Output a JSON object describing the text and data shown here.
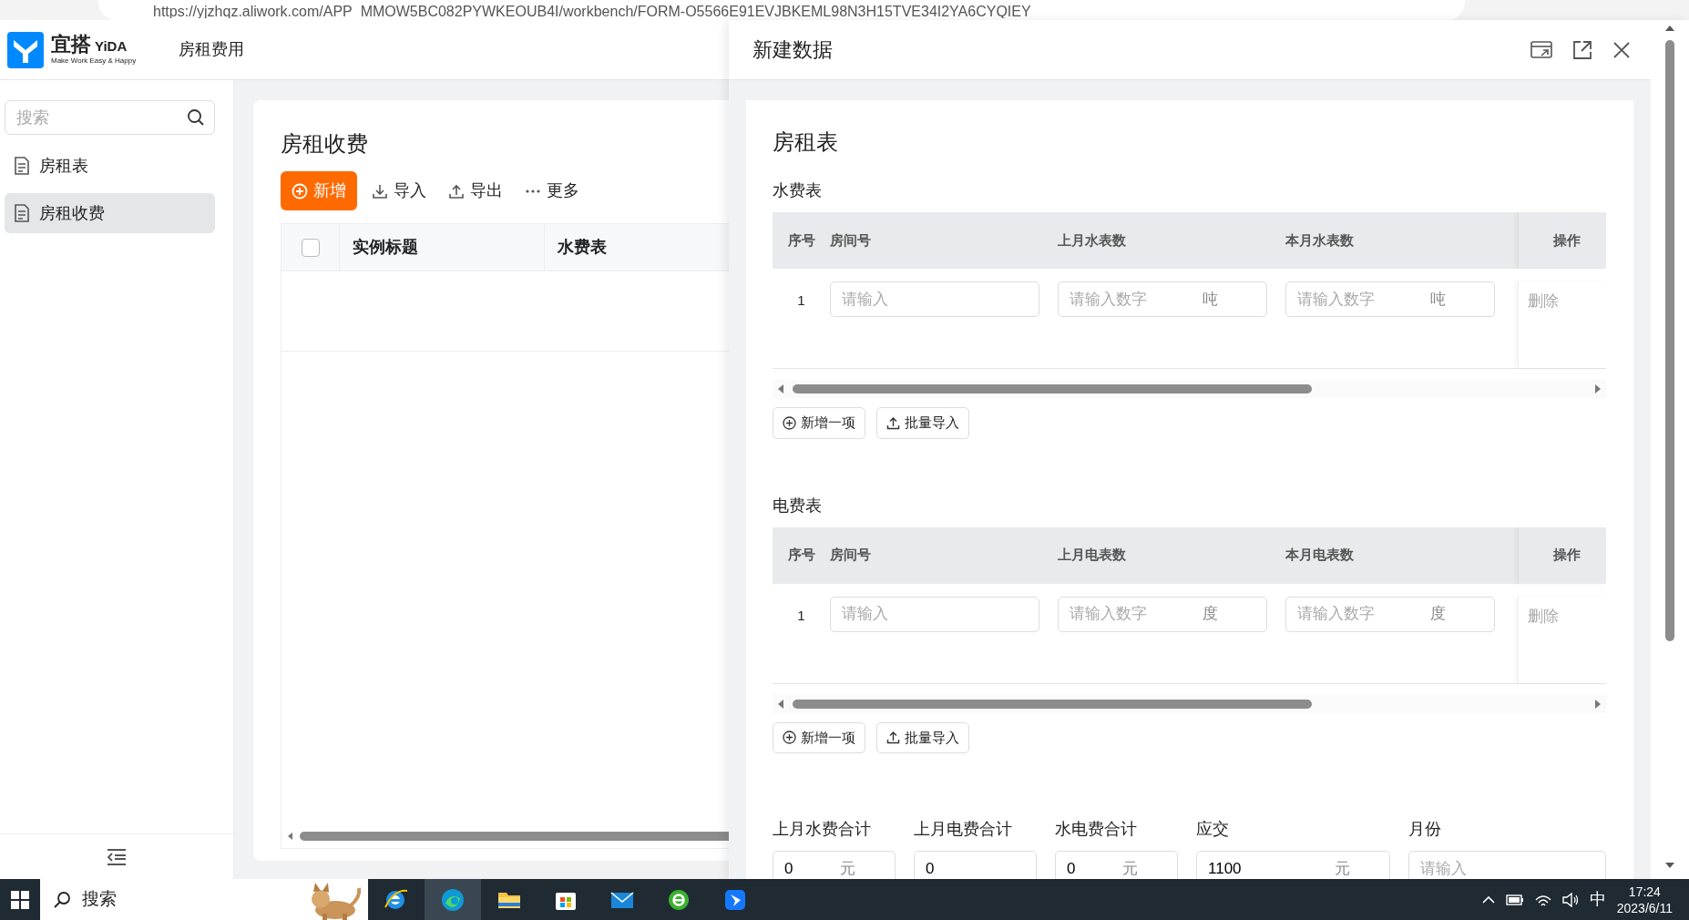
{
  "browser": {
    "url": "https://yjzhqz.aliwork.com/APP_MMOW5BC082PYWKEOUB4I/workbench/FORM-O5566E91EVJBKEML98N3H15TVE34I2YA6CYQIEY"
  },
  "app": {
    "logo": {
      "name": "宜搭",
      "wordmark": "YiDA",
      "tagline": "Make Work Easy & Happy"
    },
    "title": "房租费用"
  },
  "sidebar": {
    "search": {
      "placeholder": "搜索"
    },
    "items": [
      {
        "label": "房租表",
        "selected": false
      },
      {
        "label": "房租收费",
        "selected": true
      }
    ]
  },
  "main": {
    "title": "房租收费",
    "toolbar": [
      {
        "label": "新增",
        "kind": "primary"
      },
      {
        "label": "导入",
        "kind": "import"
      },
      {
        "label": "导出",
        "kind": "export"
      },
      {
        "label": "更多",
        "kind": "more"
      }
    ],
    "table": {
      "select_all_checked": false,
      "columns": [
        "实例标题",
        "水费表"
      ]
    }
  },
  "drawer": {
    "title": "新建数据",
    "form_title": "房租表",
    "subtables": [
      {
        "label": "水费表",
        "columns": [
          "序号",
          "房间号",
          "上月水表数",
          "本月水表数",
          "操作"
        ],
        "rows": [
          {
            "index": "1",
            "room": {
              "placeholder": "请输入"
            },
            "prev": {
              "placeholder": "请输入数字",
              "unit": "吨"
            },
            "curr": {
              "placeholder": "请输入数字",
              "unit": "吨"
            },
            "action": "删除"
          }
        ],
        "buttons": [
          {
            "label": "新增一项",
            "kind": "add"
          },
          {
            "label": "批量导入",
            "kind": "import"
          }
        ]
      },
      {
        "label": "电费表",
        "columns": [
          "序号",
          "房间号",
          "上月电表数",
          "本月电表数",
          "操作"
        ],
        "rows": [
          {
            "index": "1",
            "room": {
              "placeholder": "请输入"
            },
            "prev": {
              "placeholder": "请输入数字",
              "unit": "度"
            },
            "curr": {
              "placeholder": "请输入数字",
              "unit": "度"
            },
            "action": "删除"
          }
        ],
        "buttons": [
          {
            "label": "新增一项",
            "kind": "add"
          },
          {
            "label": "批量导入",
            "kind": "import"
          }
        ]
      }
    ],
    "fields": [
      {
        "label": "上月水费合计",
        "value": "0",
        "unit": "元"
      },
      {
        "label": "上月电费合计",
        "value": "0"
      },
      {
        "label": "水电费合计",
        "value": "0",
        "unit": "元"
      },
      {
        "label": "应交",
        "value": "1100",
        "unit": "元"
      },
      {
        "label": "月份",
        "placeholder": "请输入"
      }
    ]
  },
  "taskbar": {
    "search": "搜索",
    "apps": [
      {
        "kind": "ie",
        "selected": false
      },
      {
        "kind": "edge",
        "selected": true
      },
      {
        "kind": "folder",
        "selected": false
      },
      {
        "kind": "store",
        "selected": false
      },
      {
        "kind": "mail",
        "selected": false
      },
      {
        "kind": "green-e",
        "selected": false
      },
      {
        "kind": "bird",
        "selected": false
      }
    ],
    "tray": {
      "ime": "中",
      "time": "17:24",
      "date": "2023/6/11"
    }
  }
}
